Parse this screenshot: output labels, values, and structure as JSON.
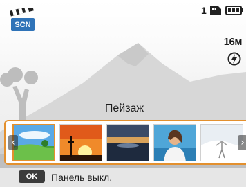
{
  "status": {
    "mode_label": "SCN",
    "shots_remaining": "1",
    "resolution": "16м",
    "mode_icon": "scene-clapper-icon",
    "card_icon": "memory-card-icon",
    "battery_icon": "battery-full-icon",
    "flash_icon": "flash-auto-icon"
  },
  "scene": {
    "title": "Пейзаж"
  },
  "strip": {
    "accent_color": "#e3902e",
    "prev_arrow": "‹",
    "next_arrow": "›",
    "thumbnails": [
      {
        "name": "landscape",
        "icon": "landscape-thumbnail"
      },
      {
        "name": "sunset",
        "icon": "sunset-thumbnail"
      },
      {
        "name": "dawn",
        "icon": "dawn-thumbnail"
      },
      {
        "name": "portrait",
        "icon": "portrait-thumbnail"
      },
      {
        "name": "snow",
        "icon": "snow-thumbnail"
      }
    ]
  },
  "bottom_bar": {
    "ok_label": "OK",
    "hint": "Панель выкл."
  }
}
